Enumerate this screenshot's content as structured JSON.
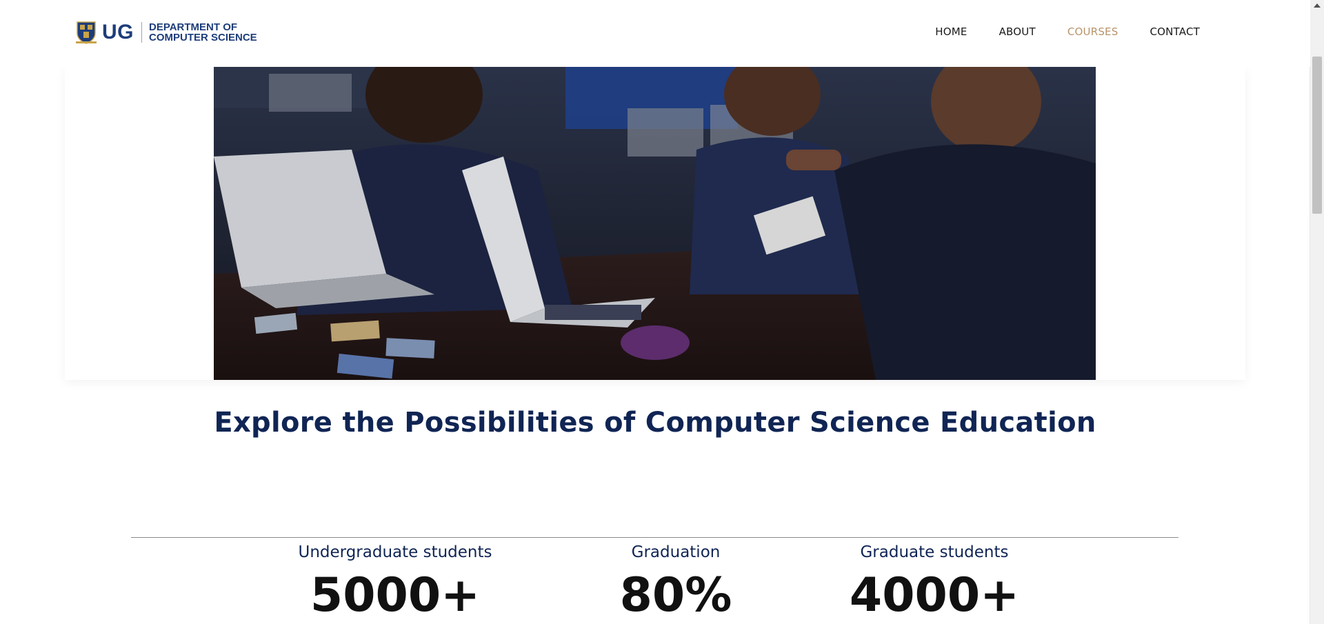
{
  "header": {
    "logo": {
      "short": "UG",
      "line1": "DEPARTMENT OF",
      "line2": "COMPUTER SCIENCE"
    },
    "nav": [
      {
        "label": "HOME",
        "active": false
      },
      {
        "label": "ABOUT",
        "active": false
      },
      {
        "label": "COURSES",
        "active": true
      },
      {
        "label": "CONTACT",
        "active": false
      }
    ]
  },
  "hero": {
    "image_icon": "classroom-photo"
  },
  "main": {
    "headline": "Explore the Possibilities of Computer Science Education"
  },
  "stats": [
    {
      "label": "Undergraduate students",
      "value": "5000+"
    },
    {
      "label": "Graduation",
      "value": "80%"
    },
    {
      "label": "Graduate students",
      "value": "4000+"
    }
  ],
  "colors": {
    "brand_navy": "#102554",
    "nav_active": "#b8936a",
    "logo_blue": "#1d3d7a"
  }
}
